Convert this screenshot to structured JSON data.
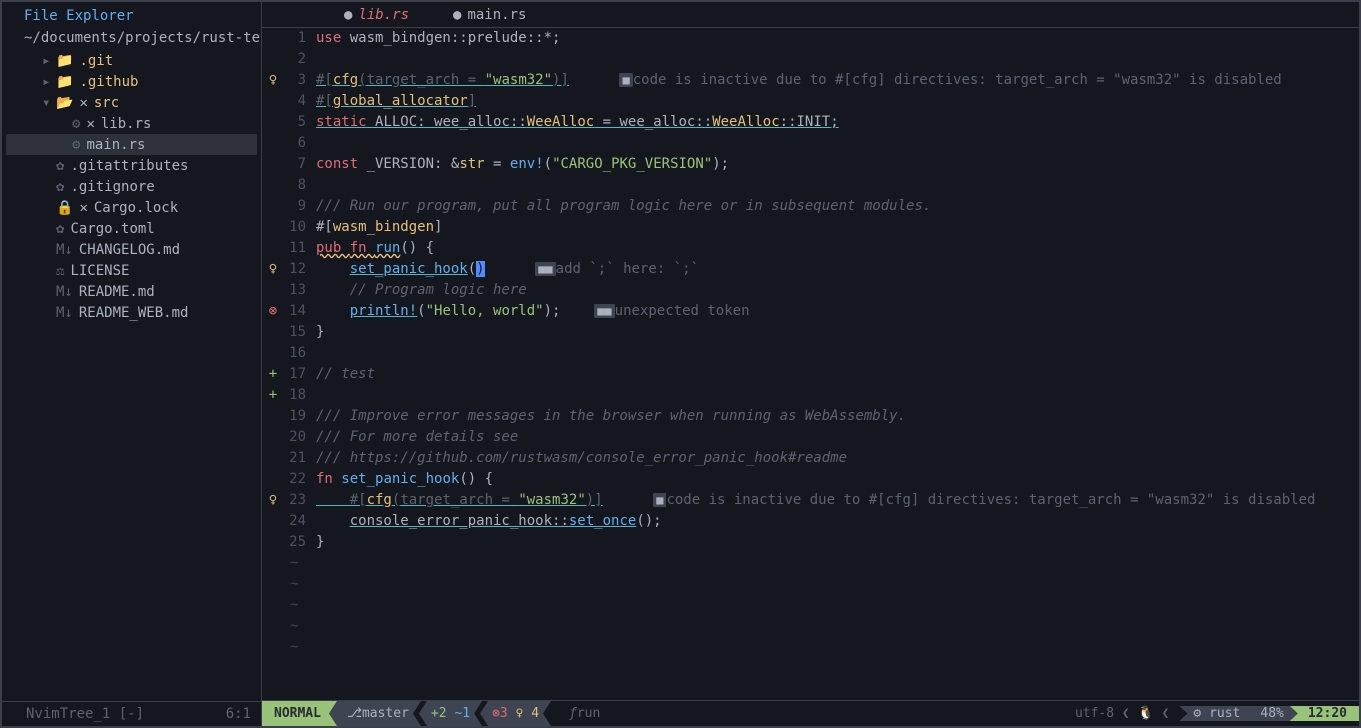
{
  "sidebar": {
    "title": "File Explorer",
    "path": "~/documents/projects/rust-te",
    "items": [
      {
        "type": "folder",
        "name": ".git",
        "expanded": false,
        "depth": 0
      },
      {
        "type": "folder",
        "name": ".github",
        "expanded": false,
        "depth": 0
      },
      {
        "type": "folder",
        "name": "src",
        "expanded": true,
        "depth": 0,
        "x": true
      },
      {
        "type": "file",
        "name": "lib.rs",
        "depth": 1,
        "icon": "rust",
        "x": true
      },
      {
        "type": "file",
        "name": "main.rs",
        "depth": 1,
        "icon": "rust",
        "selected": true
      },
      {
        "type": "file",
        "name": ".gitattributes",
        "depth": 0,
        "icon": "gear"
      },
      {
        "type": "file",
        "name": ".gitignore",
        "depth": 0,
        "icon": "gear"
      },
      {
        "type": "file",
        "name": "Cargo.lock",
        "depth": 0,
        "icon": "lock",
        "x": true
      },
      {
        "type": "file",
        "name": "Cargo.toml",
        "depth": 0,
        "icon": "gear"
      },
      {
        "type": "file",
        "name": "CHANGELOG.md",
        "depth": 0,
        "icon": "md"
      },
      {
        "type": "file",
        "name": "LICENSE",
        "depth": 0,
        "icon": "license"
      },
      {
        "type": "file",
        "name": "README.md",
        "depth": 0,
        "icon": "md"
      },
      {
        "type": "file",
        "name": "README_WEB.md",
        "depth": 0,
        "icon": "md"
      }
    ],
    "status_left": "NvimTree_1 [-]",
    "status_right": "6:1"
  },
  "tabs": [
    {
      "name": "lib.rs",
      "active": true,
      "modified": true
    },
    {
      "name": "main.rs",
      "active": false,
      "modified": true
    }
  ],
  "diagnostics": {
    "hint1": "code is inactive due to #[cfg] directives: target_arch = \"wasm32\" is disabled",
    "hint2": "add `;` here: `;`",
    "hint3": "unexpected token",
    "hint4": "code is inactive due to #[cfg] directives: target_arch = \"wasm32\" is disabled"
  },
  "code": {
    "l1a": "use ",
    "l1b": "wasm_bindgen",
    "l1c": "::",
    "l1d": "prelude",
    "l1e": "::*;",
    "l3a": "#[",
    "l3b": "cfg",
    "l3c": "(",
    "l3d": "target_arch = ",
    "l3e": "\"wasm32\"",
    "l3f": ")]",
    "l4a": "#[",
    "l4b": "global_allocator",
    "l4c": "]",
    "l5a": "static ",
    "l5b": "ALLOC",
    "l5c": ": ",
    "l5d": "wee_alloc",
    "l5e": "::",
    "l5f": "WeeAlloc",
    "l5g": " = ",
    "l5h": "wee_alloc",
    "l5i": "::",
    "l5j": "WeeAlloc",
    "l5k": "::",
    "l5l": "INIT",
    "l5m": ";",
    "l7a": "const ",
    "l7b": "_VERSION",
    "l7c": ": &",
    "l7d": "str",
    "l7e": " = ",
    "l7f": "env!",
    "l7g": "(",
    "l7h": "\"CARGO_PKG_VERSION\"",
    "l7i": ");",
    "l9": "/// Run our program, put all program logic here or in subsequent modules.",
    "l10a": "#[",
    "l10b": "wasm_bindgen",
    "l10c": "]",
    "l11a": "pub ",
    "l11b": "fn ",
    "l11c": "run",
    "l11d": "() {",
    "l12a": "    ",
    "l12b": "set_panic_hook",
    "l12c": "(",
    "l13": "    // Program logic here",
    "l14a": "    ",
    "l14b": "println!",
    "l14c": "(",
    "l14d": "\"Hello, world\"",
    "l14e": ");",
    "l15": "}",
    "l17": "// test",
    "l19": "/// Improve error messages in the browser when running as WebAssembly.",
    "l20": "/// For more details see",
    "l21": "/// https://github.com/rustwasm/console_error_panic_hook#readme",
    "l22a": "fn ",
    "l22b": "set_panic_hook",
    "l22c": "() {",
    "l23a": "    #[",
    "l23b": "cfg",
    "l23c": "(",
    "l23d": "target_arch = ",
    "l23e": "\"wasm32\"",
    "l23f": ")]",
    "l24a": "    ",
    "l24b": "console_error_panic_hook",
    "l24c": "::",
    "l24d": "set_once",
    "l24e": "();",
    "l25": "}"
  },
  "statusbar": {
    "mode": "NORMAL",
    "branch": "master",
    "diff_add": "+2",
    "diff_mod": "~1",
    "diag_err": "3",
    "diag_warn": "4",
    "fn": "run",
    "encoding": "utf-8",
    "filetype": "rust",
    "percent": "48%",
    "time": "12:20"
  }
}
